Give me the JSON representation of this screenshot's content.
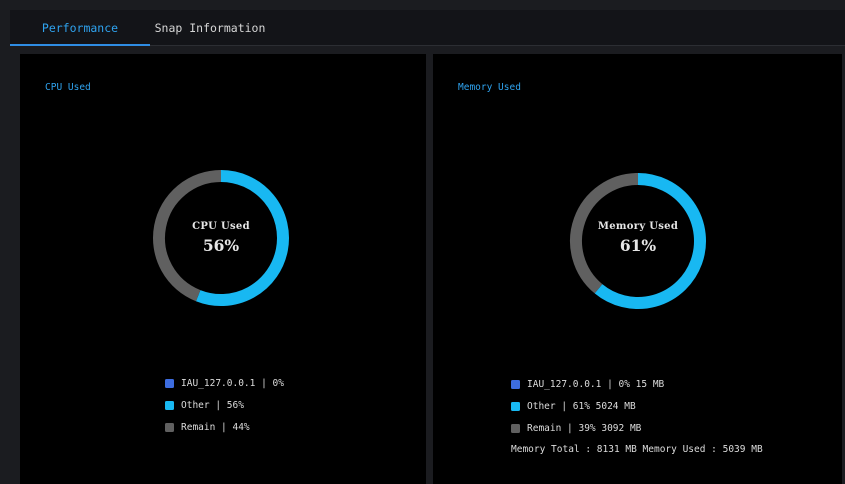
{
  "tabs": [
    {
      "label": "Performance",
      "active": true
    },
    {
      "label": "Snap Information",
      "active": false
    }
  ],
  "colors": {
    "accent": "#18b8f2",
    "accent_text": "#2fa3ef",
    "series_iau": "#3d6de0",
    "series_other": "#18b8f2",
    "series_remain": "#606060",
    "panel_bg": "#000000",
    "page_bg": "#1b1c20"
  },
  "cpu": {
    "title": "CPU Used",
    "ring_label": "CPU Used",
    "ring_value": "56%",
    "legend": [
      {
        "text": "IAU_127.0.0.1 | 0%",
        "color": "#3d6de0"
      },
      {
        "text": "Other | 56%",
        "color": "#18b8f2"
      },
      {
        "text": "Remain | 44%",
        "color": "#606060"
      }
    ]
  },
  "memory": {
    "title": "Memory Used",
    "ring_label": "Memory Used",
    "ring_value": "61%",
    "legend": [
      {
        "text": "IAU_127.0.0.1 | 0% 15 MB",
        "color": "#3d6de0"
      },
      {
        "text": "Other | 61% 5024 MB",
        "color": "#18b8f2"
      },
      {
        "text": "Remain | 39% 3092 MB",
        "color": "#606060"
      }
    ],
    "summary": "Memory Total : 8131 MB  Memory Used : 5039 MB"
  },
  "chart_data": [
    {
      "type": "pie",
      "title": "CPU Used",
      "categories": [
        "IAU_127.0.0.1",
        "Other",
        "Remain"
      ],
      "values": [
        0,
        56,
        44
      ],
      "colors": [
        "#3d6de0",
        "#18b8f2",
        "#606060"
      ]
    },
    {
      "type": "pie",
      "title": "Memory Used",
      "categories": [
        "IAU_127.0.0.1",
        "Other",
        "Remain"
      ],
      "values": [
        0,
        61,
        39
      ],
      "colors": [
        "#3d6de0",
        "#18b8f2",
        "#606060"
      ]
    }
  ]
}
